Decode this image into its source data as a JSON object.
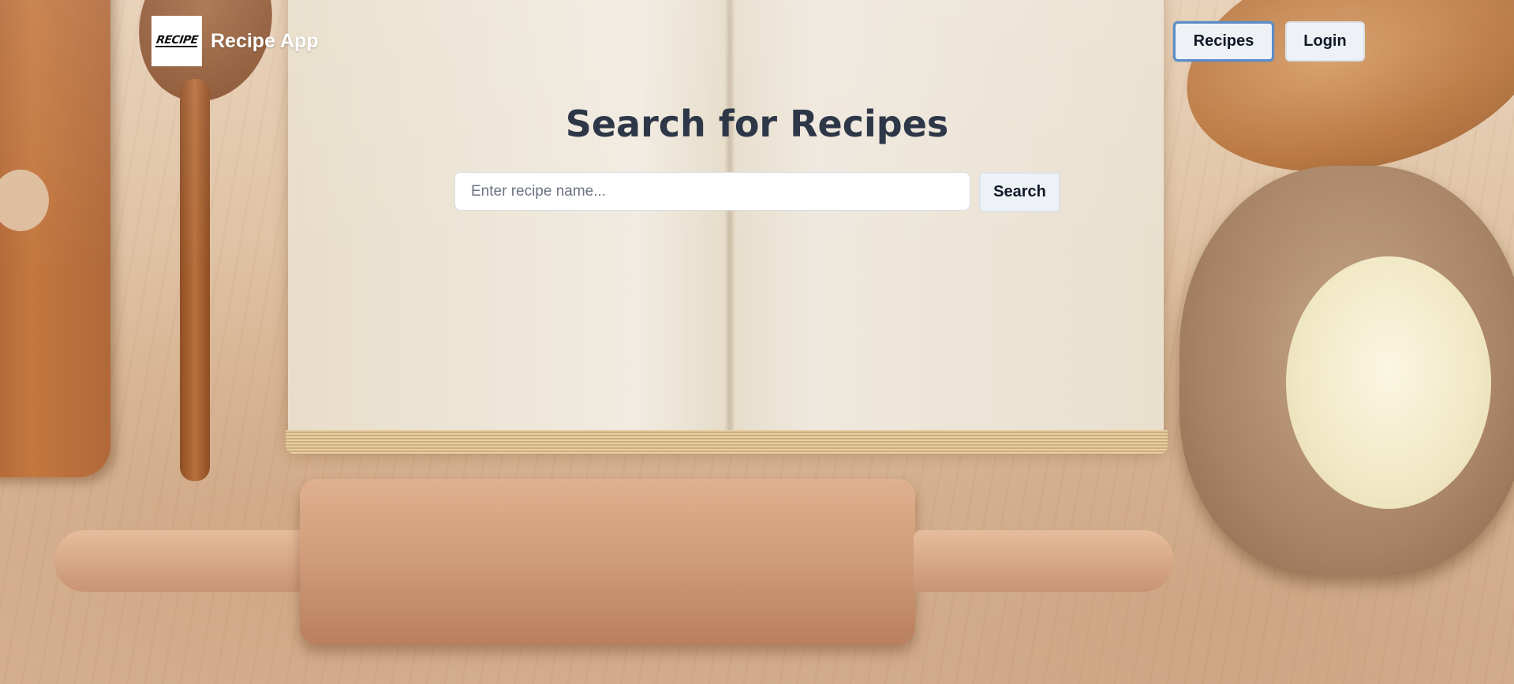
{
  "header": {
    "logo_text": "RECIPE",
    "app_title": "Recipe App",
    "nav": {
      "recipes_label": "Recipes",
      "login_label": "Login"
    }
  },
  "hero": {
    "title": "Search for Recipes",
    "search": {
      "placeholder": "Enter recipe name...",
      "value": "",
      "button_label": "Search"
    }
  },
  "theme": {
    "title_color": "#2d3748",
    "button_bg": "#eef2f6",
    "active_border": "#5b8dc9"
  }
}
